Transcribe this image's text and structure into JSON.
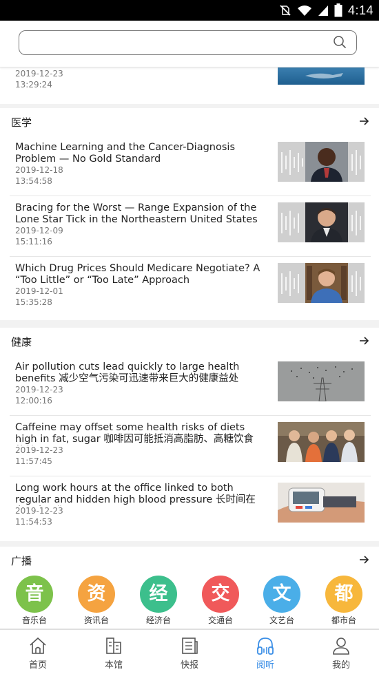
{
  "status_bar": {
    "time": "4:14",
    "icons": [
      "no-sim-icon",
      "wifi-icon",
      "signal-icon",
      "battery-icon"
    ]
  },
  "search": {
    "placeholder": ""
  },
  "partial_article": {
    "date": "2019-12-23",
    "time": "13:29:24"
  },
  "sections": [
    {
      "title": "医学",
      "articles": [
        {
          "title": "Machine Learning and the Cancer-Diagnosis Problem — No Gold Standard",
          "date": "2019-12-18",
          "time": "13:54:58"
        },
        {
          "title": "Bracing for the Worst — Range Expansion of the Lone Star Tick in the Northeastern United States",
          "date": "2019-12-09",
          "time": "15:11:16"
        },
        {
          "title": "Which Drug Prices Should Medicare Negotiate? A “Too Little” or “Too Late” Approach",
          "date": "2019-12-01",
          "time": "15:35:28"
        }
      ]
    },
    {
      "title": "健康",
      "articles": [
        {
          "title": "Air pollution cuts lead quickly to large health benefits 减少空气污染可迅速带来巨大的健康益处",
          "date": "2019-12-23",
          "time": "12:00:16"
        },
        {
          "title": "Caffeine may offset some health risks of diets high in fat, sugar 咖啡因可能抵消高脂肪、高糖饮食的某...",
          "date": "2019-12-23",
          "time": "11:57:45"
        },
        {
          "title": "Long work hours at the office linked to both regular and hidden high blood pressure 长时间在办公室工作...",
          "date": "2019-12-23",
          "time": "11:54:53"
        }
      ]
    }
  ],
  "radio": {
    "title": "广播",
    "stations": [
      {
        "char": "音",
        "label": "音乐台",
        "color": "#7dc24b"
      },
      {
        "char": "资",
        "label": "资讯台",
        "color": "#f5a340"
      },
      {
        "char": "经",
        "label": "经济台",
        "color": "#3cbf8c"
      },
      {
        "char": "交",
        "label": "交通台",
        "color": "#f0595a"
      },
      {
        "char": "文",
        "label": "文艺台",
        "color": "#4aaee8"
      },
      {
        "char": "都",
        "label": "都市台",
        "color": "#f7b73c"
      }
    ]
  },
  "bottom_nav": {
    "items": [
      {
        "label": "首页",
        "icon": "home-icon"
      },
      {
        "label": "本馆",
        "icon": "library-icon"
      },
      {
        "label": "快报",
        "icon": "newspaper-icon"
      },
      {
        "label": "阅听",
        "icon": "headphones-icon",
        "active": true
      },
      {
        "label": "我的",
        "icon": "user-icon"
      }
    ]
  },
  "colors": {
    "accent": "#3a8ee6"
  }
}
